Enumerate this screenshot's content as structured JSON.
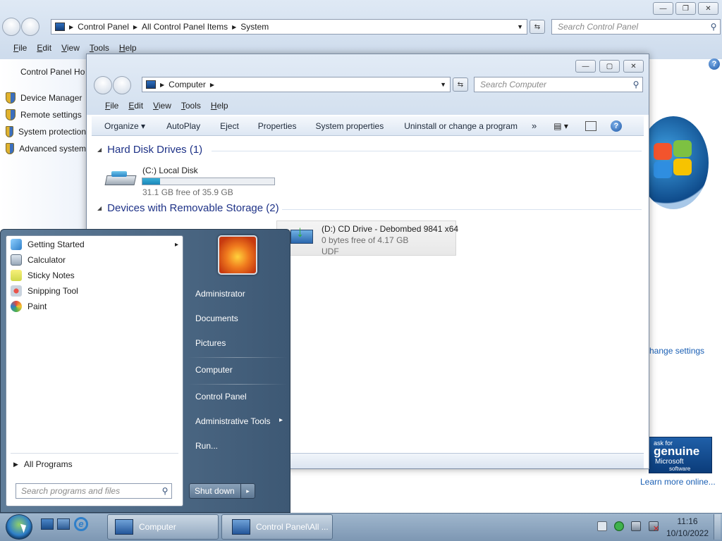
{
  "control_panel": {
    "breadcrumb": [
      "Control Panel",
      "All Control Panel Items",
      "System"
    ],
    "search_placeholder": "Search Control Panel",
    "menu": [
      "File",
      "Edit",
      "View",
      "Tools",
      "Help"
    ],
    "home_link": "Control Panel Ho",
    "links": [
      "Device Manager",
      "Remote settings",
      "System protection",
      "Advanced system"
    ],
    "change_settings": "hange settings",
    "learn_more": "Learn more online...",
    "genuine": {
      "line1": "ask for",
      "line2": "genuine",
      "line3": "Microsoft",
      "line4": "software"
    }
  },
  "computer_window": {
    "breadcrumb": "Computer",
    "search_placeholder": "Search Computer",
    "menu": [
      "File",
      "Edit",
      "View",
      "Tools",
      "Help"
    ],
    "commands": [
      "Organize ▾",
      "AutoPlay",
      "Eject",
      "Properties",
      "System properties",
      "Uninstall or change a program",
      "»"
    ],
    "groups": {
      "hdd": {
        "title": "Hard Disk Drives (1)",
        "drives": [
          {
            "name": "(C:) Local Disk",
            "free": "31.1 GB free of 35.9 GB",
            "used_fraction": 0.134
          }
        ]
      },
      "removable": {
        "title": "Devices with Removable Storage (2)",
        "drives": [
          {
            "name": "(D:) CD Drive - Debombed 9841 x64",
            "free": "0 bytes free of 4.17 GB",
            "fs": "UDF"
          }
        ]
      }
    }
  },
  "start_menu": {
    "programs": [
      {
        "label": "Getting Started",
        "arrow": "▸"
      },
      {
        "label": "Calculator"
      },
      {
        "label": "Sticky Notes"
      },
      {
        "label": "Snipping Tool"
      },
      {
        "label": "Paint"
      }
    ],
    "all_programs": "All Programs",
    "search_placeholder": "Search programs and files",
    "right": [
      "Administrator",
      "Documents",
      "Pictures",
      "Computer",
      "Control Panel",
      "Administrative Tools",
      "Run..."
    ],
    "admin_arrow": "▸",
    "shutdown": "Shut down",
    "shutdown_arrow": "▸"
  },
  "taskbar": {
    "buttons": [
      "Computer",
      "Control Panel\\All ..."
    ],
    "time": "11:16",
    "date": "10/10/2022"
  },
  "icons": {
    "help": "?",
    "search": "⚲",
    "min": "▭",
    "max": "▢",
    "close": "✕"
  }
}
